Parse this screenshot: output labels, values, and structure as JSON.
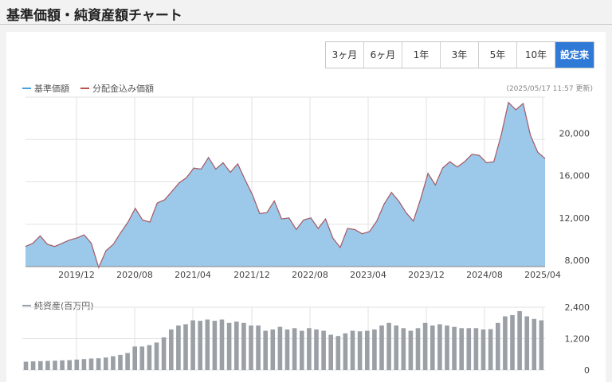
{
  "page": {
    "title": "基準価額・純資産額チャート"
  },
  "range_buttons": [
    {
      "label": "3ヶ月",
      "active": false
    },
    {
      "label": "6ヶ月",
      "active": false
    },
    {
      "label": "1年",
      "active": false
    },
    {
      "label": "3年",
      "active": false
    },
    {
      "label": "5年",
      "active": false
    },
    {
      "label": "10年",
      "active": false
    },
    {
      "label": "設定来",
      "active": true
    }
  ],
  "legend": {
    "nav_label": "基準価額",
    "adjusted_label": "分配金込み価額",
    "net_assets_label": "純資産(百万円)",
    "updated": "(2025/05/17 11:57 更新)"
  },
  "colors": {
    "nav": "#4a9fdc",
    "adjusted": "#c0504d",
    "fill": "#9cc8ea",
    "bars": "#9aa0a6",
    "active": "#2f7ad6"
  },
  "chart_data": [
    {
      "type": "area",
      "x_tick_labels": [
        "2019/12",
        "2020/08",
        "2021/04",
        "2021/12",
        "2022/08",
        "2023/04",
        "2023/12",
        "2024/08",
        "2025/04"
      ],
      "y_tick_labels": [
        "8,000",
        "12,000",
        "16,000",
        "20,000"
      ],
      "ylim": [
        8000,
        24000
      ],
      "series": [
        {
          "name": "基準価額",
          "values": [
            9900,
            10200,
            10900,
            10100,
            9900,
            10200,
            10500,
            10700,
            11000,
            10200,
            7900,
            9500,
            10100,
            11200,
            12200,
            13500,
            12400,
            12200,
            14000,
            14300,
            15100,
            15900,
            16400,
            17300,
            17200,
            18300,
            17200,
            17800,
            16900,
            17700,
            16200,
            14800,
            13000,
            13100,
            14200,
            12500,
            12600,
            11500,
            12400,
            12600,
            11600,
            12500,
            10700,
            9800,
            11600,
            11500,
            11100,
            11300,
            12300,
            13900,
            15000,
            14200,
            13100,
            12300,
            14400,
            16800,
            15700,
            17300,
            17900,
            17400,
            17900,
            18600,
            18500,
            17800,
            17900,
            20400,
            23500,
            22800,
            23400,
            20400,
            18800,
            18200
          ]
        },
        {
          "name": "分配金込み価額",
          "values": [
            9900,
            10200,
            10900,
            10100,
            9900,
            10200,
            10500,
            10700,
            11000,
            10200,
            7900,
            9500,
            10100,
            11200,
            12200,
            13500,
            12400,
            12200,
            14000,
            14300,
            15100,
            15900,
            16400,
            17300,
            17200,
            18300,
            17200,
            17800,
            16900,
            17700,
            16200,
            14800,
            13000,
            13100,
            14200,
            12500,
            12600,
            11500,
            12400,
            12600,
            11600,
            12500,
            10700,
            9800,
            11600,
            11500,
            11100,
            11300,
            12300,
            13900,
            15000,
            14200,
            13100,
            12300,
            14400,
            16800,
            15700,
            17300,
            17900,
            17400,
            17900,
            18600,
            18500,
            17800,
            17900,
            20400,
            23500,
            22800,
            23400,
            20400,
            18800,
            18200
          ]
        }
      ],
      "grid": true
    },
    {
      "type": "bar",
      "y_tick_labels": [
        "0",
        "1,200",
        "2,400"
      ],
      "ylim": [
        0,
        2400
      ],
      "series": [
        {
          "name": "純資産(百万円)",
          "values": [
            320,
            330,
            340,
            350,
            360,
            370,
            380,
            400,
            420,
            440,
            450,
            480,
            530,
            580,
            650,
            900,
            900,
            950,
            1050,
            1250,
            1550,
            1700,
            1750,
            1900,
            1880,
            1930,
            1880,
            1930,
            1800,
            1850,
            1800,
            1700,
            1700,
            1500,
            1550,
            1650,
            1550,
            1600,
            1500,
            1600,
            1550,
            1500,
            1350,
            1300,
            1400,
            1500,
            1480,
            1500,
            1550,
            1700,
            1800,
            1700,
            1600,
            1500,
            1600,
            1800,
            1700,
            1750,
            1700,
            1650,
            1600,
            1600,
            1600,
            1550,
            1560,
            1800,
            2050,
            2100,
            2250,
            2050,
            1950,
            1900
          ]
        }
      ],
      "grid": true
    }
  ]
}
